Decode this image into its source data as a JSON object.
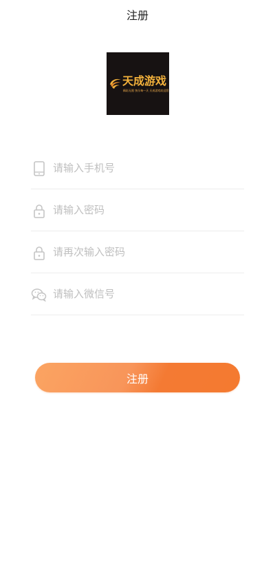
{
  "header": {
    "title": "注册"
  },
  "logo": {
    "text": "天成游戏",
    "slogan": "精彩无限 快乐每一天 天成游戏欢迎您"
  },
  "form": {
    "fields": [
      {
        "icon": "phone-icon",
        "placeholder": "请输入手机号",
        "value": ""
      },
      {
        "icon": "lock-icon",
        "placeholder": "请输入密码",
        "value": ""
      },
      {
        "icon": "lock-icon",
        "placeholder": "请再次输入密码",
        "value": ""
      },
      {
        "icon": "wechat-icon",
        "placeholder": "请输入微信号",
        "value": ""
      }
    ],
    "submit_label": "注册"
  },
  "colors": {
    "accent": "#f47a30",
    "accent_light": "#fba462",
    "icon": "#c4c4c4",
    "divider": "#ececec",
    "logo_bg": "#171212",
    "logo_text": "#f3b13b"
  }
}
